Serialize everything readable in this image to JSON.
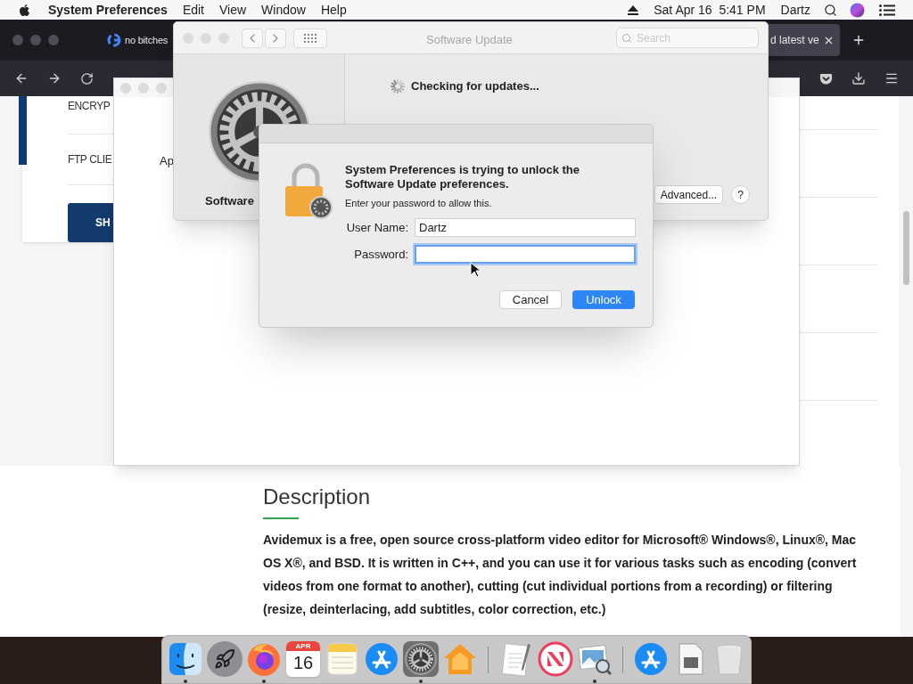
{
  "menubar": {
    "app_name": "System Preferences",
    "menus": [
      "Edit",
      "View",
      "Window",
      "Help"
    ],
    "clock": "Sat Apr 16  5:41 PM",
    "user": "Dartz"
  },
  "browser": {
    "tabs": [
      {
        "title": "no bitches",
        "selected": false
      },
      {
        "title": "d latest ve",
        "selected": true
      }
    ],
    "sidebar_items": [
      "ENCRYP",
      "FTP CLIE"
    ],
    "sidebar_button": "SH",
    "section_heading": "Description",
    "paragraph": "Avidemux is a free, open source cross-platform video editor for Microsoft® Windows®, Linux®, Mac OS X®, and BSD. It is written in C++, and you can use it for various tasks such as encoding (convert videos from one format to another), cutting (cut individual portions from a recording) or filtering (resize, deinterlacing, add subtitles, color correction, etc.)"
  },
  "background_window": {
    "label": "Ap"
  },
  "software_update": {
    "title": "Software Update",
    "search_placeholder": "Search",
    "pane_label": "Software",
    "status": "Checking for updates...",
    "advanced_button": "Advanced...",
    "help_button": "?"
  },
  "auth_dialog": {
    "heading": "System Preferences is trying to unlock the Software Update preferences.",
    "message": "Enter your password to allow this.",
    "fields": [
      {
        "label": "User Name:",
        "value": "Dartz",
        "focused": false
      },
      {
        "label": "Password:",
        "focused": true
      }
    ],
    "buttons": [
      {
        "label": "Cancel",
        "default": false
      },
      {
        "label": "Unlock",
        "default": true
      }
    ]
  },
  "dock": {
    "items": [
      {
        "kind": "finder",
        "running": true
      },
      {
        "kind": "launchpad",
        "running": false
      },
      {
        "kind": "firefox",
        "running": true
      },
      {
        "kind": "calendar",
        "running": false,
        "month": "APR",
        "day": "16"
      },
      {
        "kind": "notes",
        "running": false
      },
      {
        "kind": "appstore",
        "running": false
      },
      {
        "kind": "sysprefs",
        "running": true
      },
      {
        "kind": "home",
        "running": false
      },
      {
        "kind": "separator"
      },
      {
        "kind": "textedit",
        "running": false
      },
      {
        "kind": "news",
        "running": false
      },
      {
        "kind": "preview",
        "running": true
      },
      {
        "kind": "separator"
      },
      {
        "kind": "appstore",
        "running": false
      },
      {
        "kind": "file",
        "running": false
      },
      {
        "kind": "trash",
        "running": false
      }
    ]
  }
}
